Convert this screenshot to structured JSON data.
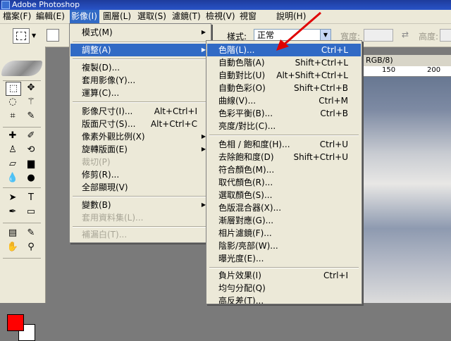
{
  "window": {
    "title": "Adobe Photoshop"
  },
  "menubar": [
    {
      "label": "檔案(F)",
      "active": false
    },
    {
      "label": "編輯(E)",
      "active": false
    },
    {
      "label": "影像(I)",
      "active": true
    },
    {
      "label": "圖層(L)",
      "active": false
    },
    {
      "label": "選取(S)",
      "active": false
    },
    {
      "label": "濾鏡(T)",
      "active": false
    },
    {
      "label": "檢視(V)",
      "active": false
    },
    {
      "label": "視窗(W)",
      "active": false
    },
    {
      "label": "說明(H)",
      "active": false
    }
  ],
  "options": {
    "style_label": "樣式:",
    "style_value": "正常",
    "width_label": "寬度:",
    "height_label": "高度:"
  },
  "document": {
    "title_fragment": ", RGB/8)",
    "ruler_labels": [
      "150",
      "200"
    ]
  },
  "colors": {
    "foreground": "#ff0000",
    "background": "#ffffff",
    "menu_highlight": "#316ac5"
  },
  "image_menu": [
    {
      "label": "模式(M)",
      "submenu": true
    },
    {
      "type": "sep"
    },
    {
      "label": "調整(A)",
      "submenu": true,
      "highlight": true
    },
    {
      "type": "sep"
    },
    {
      "label": "複製(D)..."
    },
    {
      "label": "套用影像(Y)..."
    },
    {
      "label": "運算(C)..."
    },
    {
      "type": "sep"
    },
    {
      "label": "影像尺寸(I)...",
      "shortcut": "Alt+Ctrl+I"
    },
    {
      "label": "版面尺寸(S)...",
      "shortcut": "Alt+Ctrl+C"
    },
    {
      "label": "像素外觀比例(X)",
      "submenu": true
    },
    {
      "label": "旋轉版面(E)",
      "submenu": true
    },
    {
      "label": "裁切(P)",
      "disabled": true
    },
    {
      "label": "修剪(R)..."
    },
    {
      "label": "全部顯現(V)"
    },
    {
      "type": "sep"
    },
    {
      "label": "變數(B)",
      "submenu": true
    },
    {
      "label": "套用資料集(L)...",
      "disabled": true
    },
    {
      "type": "sep"
    },
    {
      "label": "補漏白(T)...",
      "disabled": true
    }
  ],
  "adjust_menu": [
    {
      "label": "色階(L)...",
      "shortcut": "Ctrl+L",
      "highlight": true
    },
    {
      "label": "自動色階(A)",
      "shortcut": "Shift+Ctrl+L"
    },
    {
      "label": "自動對比(U)",
      "shortcut": "Alt+Shift+Ctrl+L"
    },
    {
      "label": "自動色彩(O)",
      "shortcut": "Shift+Ctrl+B"
    },
    {
      "label": "曲線(V)...",
      "shortcut": "Ctrl+M"
    },
    {
      "label": "色彩平衡(B)...",
      "shortcut": "Ctrl+B"
    },
    {
      "label": "亮度/對比(C)..."
    },
    {
      "type": "sep"
    },
    {
      "label": "色相 / 飽和度(H)...",
      "shortcut": "Ctrl+U"
    },
    {
      "label": "去除飽和度(D)",
      "shortcut": "Shift+Ctrl+U"
    },
    {
      "label": "符合顏色(M)..."
    },
    {
      "label": "取代顏色(R)..."
    },
    {
      "label": "選取顏色(S)..."
    },
    {
      "label": "色版混合器(X)..."
    },
    {
      "label": "漸層對應(G)..."
    },
    {
      "label": "相片濾鏡(F)..."
    },
    {
      "label": "陰影/亮部(W)..."
    },
    {
      "label": "曝光度(E)..."
    },
    {
      "type": "sep"
    },
    {
      "label": "負片效果(I)",
      "shortcut": "Ctrl+I"
    },
    {
      "label": "均勻分配(Q)"
    },
    {
      "label": "高反差(T)..."
    }
  ]
}
